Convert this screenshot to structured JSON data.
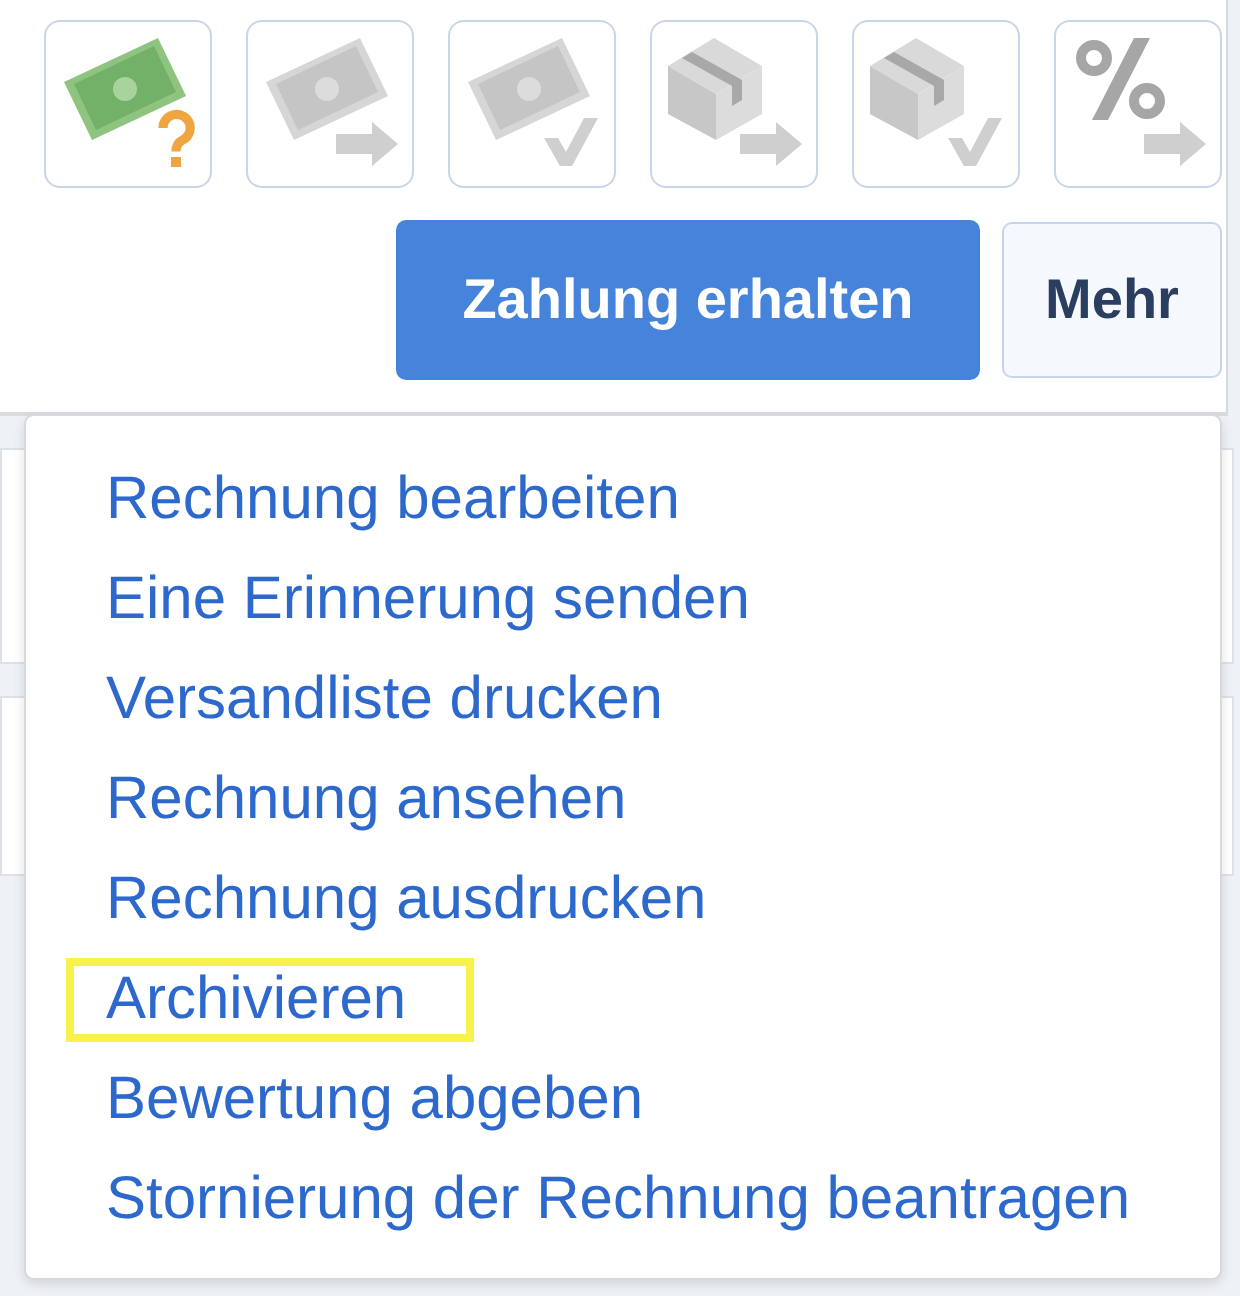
{
  "status_icons": [
    {
      "kind": "banknote-question",
      "active": true
    },
    {
      "kind": "banknote-arrow",
      "active": false
    },
    {
      "kind": "banknote-check",
      "active": false
    },
    {
      "kind": "box-arrow",
      "active": false
    },
    {
      "kind": "box-check",
      "active": false
    },
    {
      "kind": "percent-arrow",
      "active": false
    }
  ],
  "actions": {
    "primary": "Zahlung erhalten",
    "more": "Mehr"
  },
  "menu": {
    "items": [
      {
        "label": "Rechnung bearbeiten",
        "highlighted": false
      },
      {
        "label": "Eine Erinnerung senden",
        "highlighted": false
      },
      {
        "label": "Versandliste drucken",
        "highlighted": false
      },
      {
        "label": "Rechnung ansehen",
        "highlighted": false
      },
      {
        "label": "Rechnung ausdrucken",
        "highlighted": false
      },
      {
        "label": "Archivieren",
        "highlighted": true
      },
      {
        "label": "Bewertung abgeben",
        "highlighted": false
      },
      {
        "label": "Stornierung der Rechnung beantragen",
        "highlighted": false
      }
    ]
  }
}
